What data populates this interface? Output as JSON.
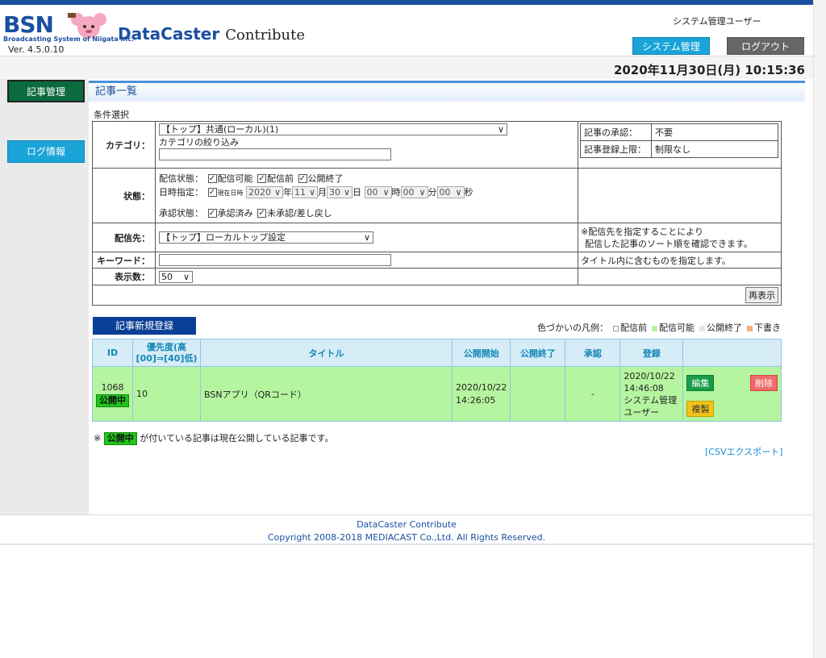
{
  "header": {
    "logo_text": "BSN",
    "logo_tagline": "Broadcasting System of Niigata Inc.",
    "app_title_main": "DataCaster",
    "app_title_sub": "Contribute",
    "version": "Ver. 4.5.0.10",
    "user": "システム管理ユーザー",
    "system_admin_button": "システム管理",
    "logout_button": "ログアウト",
    "datetime": "2020年11月30日(月) 10:15:36"
  },
  "sidebar": {
    "items": [
      {
        "label": "記事管理"
      },
      {
        "label": "ログ情報"
      }
    ]
  },
  "main": {
    "section_title": "記事一覧",
    "conditions_label": "条件選択",
    "category": {
      "label": "カテゴリ：",
      "selected": "【トップ】共通(ローカル)(1)",
      "filter_label": "カテゴリの絞り込み",
      "filter_value": "",
      "approval_label": "記事の承認：",
      "approval_value": "不要",
      "limit_label": "記事登録上限：",
      "limit_value": "制限なし"
    },
    "status": {
      "label": "状態：",
      "delivery_label": "配信状態：",
      "delivery_options": [
        "配信可能",
        "配信前",
        "公開終了"
      ],
      "date_label": "日時指定：",
      "now_label": "現在日時",
      "year": "2020",
      "year_unit": "年",
      "month": "11",
      "month_unit": "月",
      "day": "30",
      "day_unit": "日",
      "hour": "00",
      "hour_unit": "時",
      "minute": "00",
      "minute_unit": "分",
      "second": "00",
      "second_unit": "秒",
      "approval_label": "承認状態：",
      "approval_options": [
        "承認済み",
        "未承認/差し戻し"
      ]
    },
    "destination": {
      "label": "配信先：",
      "selected": "【トップ】ローカルトップ設定",
      "note_line1": "※配信先を指定することにより",
      "note_line2": "配信した記事のソート順を確認できます。"
    },
    "keyword": {
      "label": "キーワード：",
      "value": "",
      "note": "タイトル内に含むものを指定します。"
    },
    "display_count": {
      "label": "表示数：",
      "selected": "50"
    },
    "reshow_button": "再表示",
    "new_article_button": "記事新規登録",
    "legend": {
      "label": "色づかいの凡例：",
      "items": [
        {
          "name": "配信前",
          "color": "#ffffff"
        },
        {
          "name": "配信可能",
          "color": "#b6f5a0"
        },
        {
          "name": "公開終了",
          "color": "#e6e6e6"
        },
        {
          "name": "下書き",
          "color": "#f5b07a"
        }
      ]
    },
    "table": {
      "headers": [
        "ID",
        "優先度(高[00]⇒[40]低)",
        "タイトル",
        "公開開始",
        "公開終了",
        "承認",
        "登録",
        ""
      ],
      "rows": [
        {
          "id": "1068",
          "badge": "公開中",
          "priority": "10",
          "title": "BSNアプリ（QRコード）",
          "publish_start_date": "2020/10/22",
          "publish_start_time": "14:26:05",
          "publish_end": "",
          "approval": "-",
          "registered_date": "2020/10/22",
          "registered_time": "14:46:08",
          "registered_by_1": "システム管理",
          "registered_by_2": "ユーザー",
          "edit": "編集",
          "delete": "削除",
          "copy": "複製"
        }
      ]
    },
    "note_prefix": "※",
    "note_badge": "公開中",
    "note_text": "が付いている記事は現在公開している記事です。",
    "csv_link": "[CSVエクスポート]"
  },
  "footer": {
    "line1": "DataCaster Contribute",
    "line2": "Copyright 2008-2018 MEDIACAST Co.,Ltd. All Rights Reserved."
  }
}
